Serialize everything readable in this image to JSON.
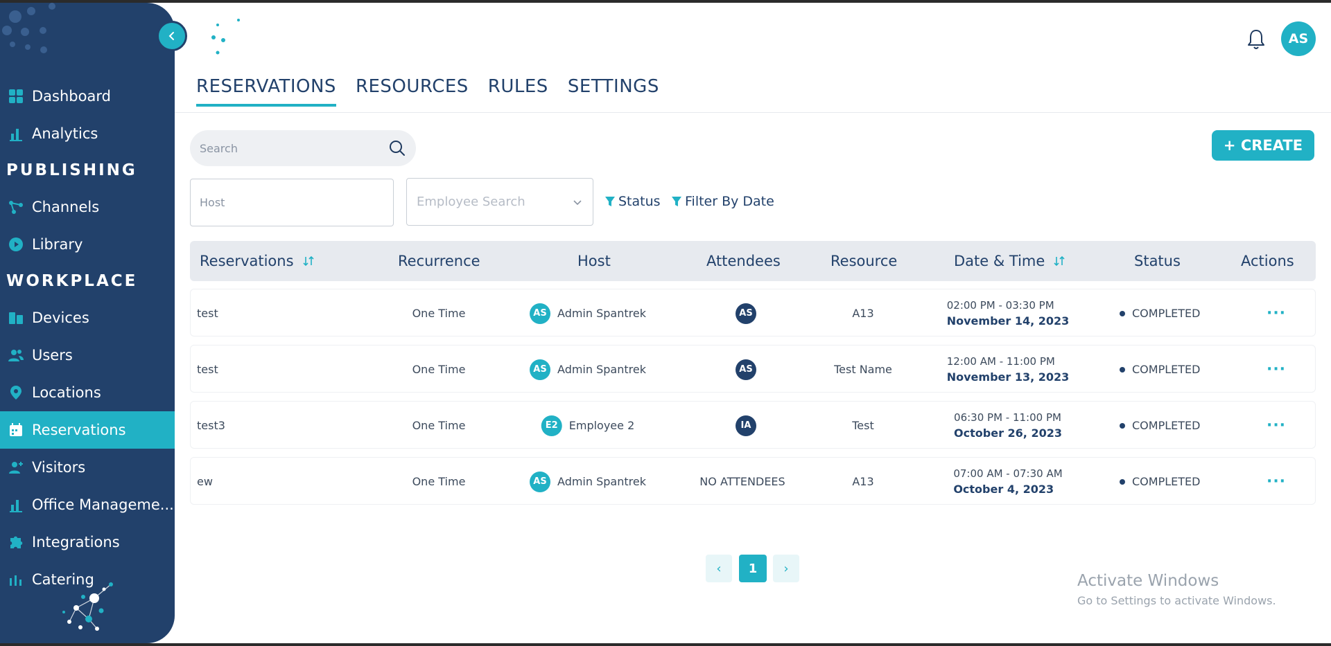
{
  "sidebar": {
    "nav": [
      {
        "label": "Dashboard",
        "icon": "dashboard-icon"
      },
      {
        "label": "Analytics",
        "icon": "analytics-icon"
      },
      {
        "section": "PUBLISHING"
      },
      {
        "label": "Channels",
        "icon": "channels-icon"
      },
      {
        "label": "Library",
        "icon": "library-icon"
      },
      {
        "section": "WORKPLACE"
      },
      {
        "label": "Devices",
        "icon": "devices-icon"
      },
      {
        "label": "Users",
        "icon": "users-icon"
      },
      {
        "label": "Locations",
        "icon": "location-pin-icon"
      },
      {
        "label": "Reservations",
        "icon": "calendar-icon",
        "active": true
      },
      {
        "label": "Visitors",
        "icon": "visitor-icon"
      },
      {
        "label": "Office Manageme...",
        "icon": "office-management-icon"
      },
      {
        "label": "Integrations",
        "icon": "puzzle-icon"
      },
      {
        "label": "Catering",
        "icon": "catering-icon"
      }
    ]
  },
  "header": {
    "avatar_initials": "AS"
  },
  "tabs": [
    {
      "label": "RESERVATIONS",
      "active": true
    },
    {
      "label": "RESOURCES"
    },
    {
      "label": "RULES"
    },
    {
      "label": "SETTINGS"
    }
  ],
  "toolbar": {
    "search_placeholder": "Search",
    "create_label": "+ CREATE",
    "host_placeholder": "Host",
    "employee_placeholder": "Employee Search",
    "status_filter": "Status",
    "date_filter": "Filter By Date"
  },
  "table": {
    "columns": [
      "Reservations",
      "Recurrence",
      "Host",
      "Attendees",
      "Resource",
      "Date & Time",
      "Status",
      "Actions"
    ],
    "rows": [
      {
        "name": "test",
        "recurrence": "One Time",
        "host_initials": "AS",
        "host": "Admin Spantrek",
        "attendees": "AS",
        "resource": "A13",
        "time": "02:00 PM - 03:30 PM",
        "date": "November 14, 2023",
        "status": "COMPLETED",
        "actions": "···"
      },
      {
        "name": "test",
        "recurrence": "One Time",
        "host_initials": "AS",
        "host": "Admin Spantrek",
        "attendees": "AS",
        "resource": "Test Name",
        "time": "12:00 AM - 11:00 PM",
        "date": "November 13, 2023",
        "status": "COMPLETED",
        "actions": "···"
      },
      {
        "name": "test3",
        "recurrence": "One Time",
        "host_initials": "E2",
        "host": "Employee 2",
        "attendees": "IA",
        "resource": "Test",
        "time": "06:30 PM - 11:00 PM",
        "date": "October 26, 2023",
        "status": "COMPLETED",
        "actions": "···"
      },
      {
        "name": "ew",
        "recurrence": "One Time",
        "host_initials": "AS",
        "host": "Admin Spantrek",
        "attendees": "NO ATTENDEES",
        "resource": "A13",
        "time": "07:00 AM - 07:30 AM",
        "date": "October 4, 2023",
        "status": "COMPLETED",
        "actions": "···"
      }
    ]
  },
  "pagination": {
    "prev": "‹",
    "current": "1",
    "next": "›"
  },
  "watermark": {
    "title": "Activate Windows",
    "subtitle": "Go to Settings to activate Windows."
  },
  "colors": {
    "navy": "#22416b",
    "teal": "#21b1c5"
  }
}
